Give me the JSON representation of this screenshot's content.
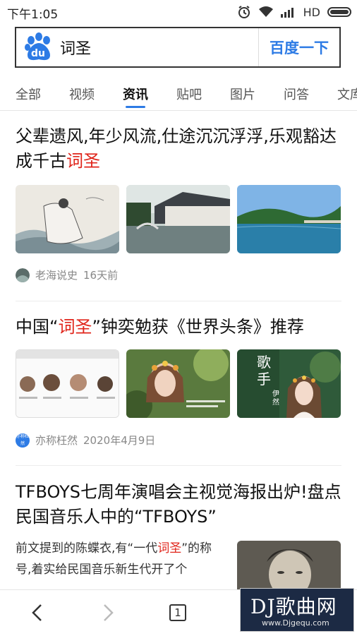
{
  "status_bar": {
    "time": "下午1:05",
    "network": "HD"
  },
  "search": {
    "query": "词圣",
    "button_label": "百度一下",
    "logo_text": "du"
  },
  "tabs": [
    {
      "label": "全部"
    },
    {
      "label": "视频"
    },
    {
      "label": "资讯",
      "active": true
    },
    {
      "label": "贴吧"
    },
    {
      "label": "图片"
    },
    {
      "label": "问答"
    },
    {
      "label": "文库"
    }
  ],
  "articles": [
    {
      "title_parts": [
        "父辈遗风,年少风流,仕途沉沉浮浮,乐观豁达成千古",
        "词圣"
      ],
      "source": "老海说史",
      "time": "16天前"
    },
    {
      "title_parts": [
        "中国“",
        "词圣",
        "”钟奕勉获《世界头条》推荐"
      ],
      "source": "亦称枉然",
      "time": "2020年4月9日",
      "avatar_text": "亦称枉然",
      "thumb3_text": "歌手",
      "thumb3_sub": "伊然"
    },
    {
      "title": "TFBOYS七周年演唱会主视觉海报出炉!盘点民国音乐人中的“TFBOYS”",
      "snippet_parts": [
        "前文提到的陈蝶衣,有“一代",
        "词圣",
        "”的称号,着实给民国音乐新生代开了个"
      ]
    }
  ],
  "bottom_nav": {
    "tab_count": "1"
  },
  "watermark": {
    "logo": "DJ歌曲网",
    "url": "www.Djgequ.com"
  },
  "colors": {
    "accent": "#2d7be5",
    "highlight": "#e0251b",
    "watermark_bg": "#1c2a44"
  }
}
